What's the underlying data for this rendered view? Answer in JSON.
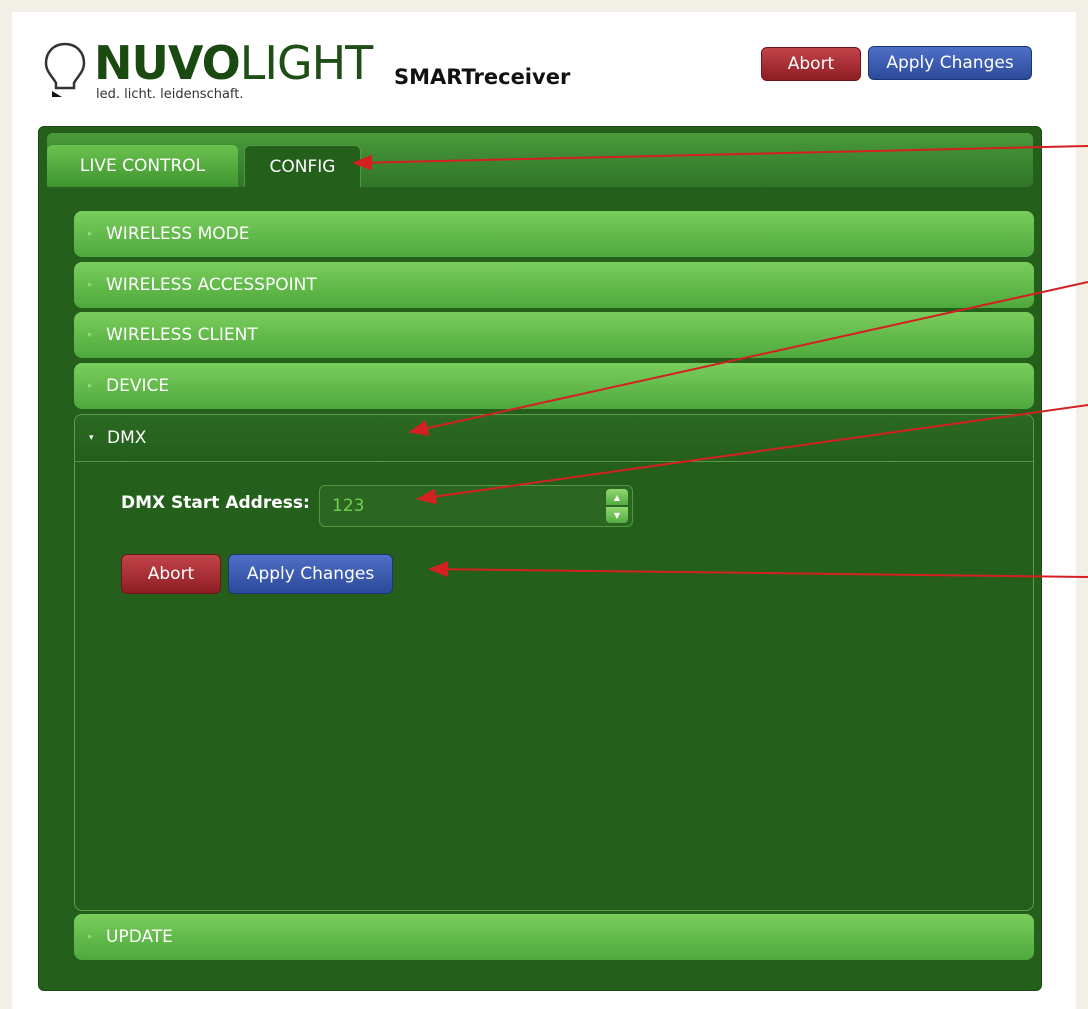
{
  "header": {
    "brand_bold": "NUVO",
    "brand_thin": "LIGHT",
    "tagline": "led. licht. leidenschaft.",
    "app_title": "SMARTreceiver",
    "abort_label": "Abort",
    "apply_label": "Apply Changes"
  },
  "tabs": [
    {
      "label": "LIVE CONTROL"
    },
    {
      "label": "CONFIG"
    }
  ],
  "sections": [
    {
      "label": "WIRELESS MODE"
    },
    {
      "label": "WIRELESS ACCESSPOINT"
    },
    {
      "label": "WIRELESS CLIENT"
    },
    {
      "label": "DEVICE"
    },
    {
      "label": "DMX"
    },
    {
      "label": "UPDATE"
    }
  ],
  "dmx": {
    "start_address_label": "DMX Start Address:",
    "start_address_value": "123",
    "abort_label": "Abort",
    "apply_label": "Apply Changes"
  },
  "colors": {
    "panel_bg": "#245f1c",
    "accordion_green": "#5fb846",
    "abort_red": "#a8252d",
    "apply_blue": "#3a5cb4",
    "annotation_arrow": "#d42020"
  }
}
